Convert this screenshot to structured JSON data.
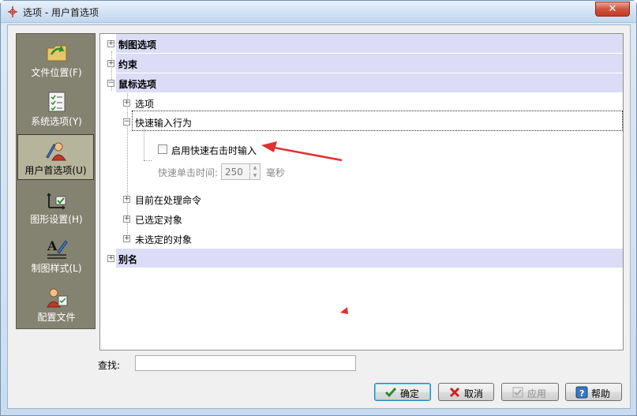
{
  "window": {
    "title": "选项 - 用户首选项",
    "close_glyph": "✕"
  },
  "sidebar": {
    "items": [
      {
        "label": "文件位置(F)",
        "icon": "folder-icon"
      },
      {
        "label": "系统选项(Y)",
        "icon": "checklist-icon"
      },
      {
        "label": "用户首选项(U)",
        "icon": "user-pencil-icon",
        "selected": true
      },
      {
        "label": "图形设置(H)",
        "icon": "graphic-settings-icon"
      },
      {
        "label": "制图样式(L)",
        "icon": "drafting-style-icon"
      },
      {
        "label": "配置文件",
        "icon": "profile-icon"
      }
    ]
  },
  "tree": {
    "nodes": {
      "drawing_options": "制图选项",
      "constraints": "约束",
      "mouse_options": "鼠标选项",
      "options": "选项",
      "quick_input": "快速输入行为",
      "enable_quick_right_click": "启用快速右击时输入",
      "quick_click_time_label": "快速单击时间:",
      "quick_click_time_value": "250",
      "quick_click_time_unit": "毫秒",
      "current_command": "目前在处理命令",
      "selected_objects": "已选定对象",
      "unselected_objects": "未选定的对象",
      "aliases": "别名"
    },
    "expander_plus": "+",
    "expander_minus": "−"
  },
  "find": {
    "label": "查找:",
    "value": ""
  },
  "buttons": {
    "ok": "确定",
    "cancel": "取消",
    "apply": "应用",
    "help": "帮助"
  },
  "annotations": {
    "arrow_color": "#e03030"
  }
}
